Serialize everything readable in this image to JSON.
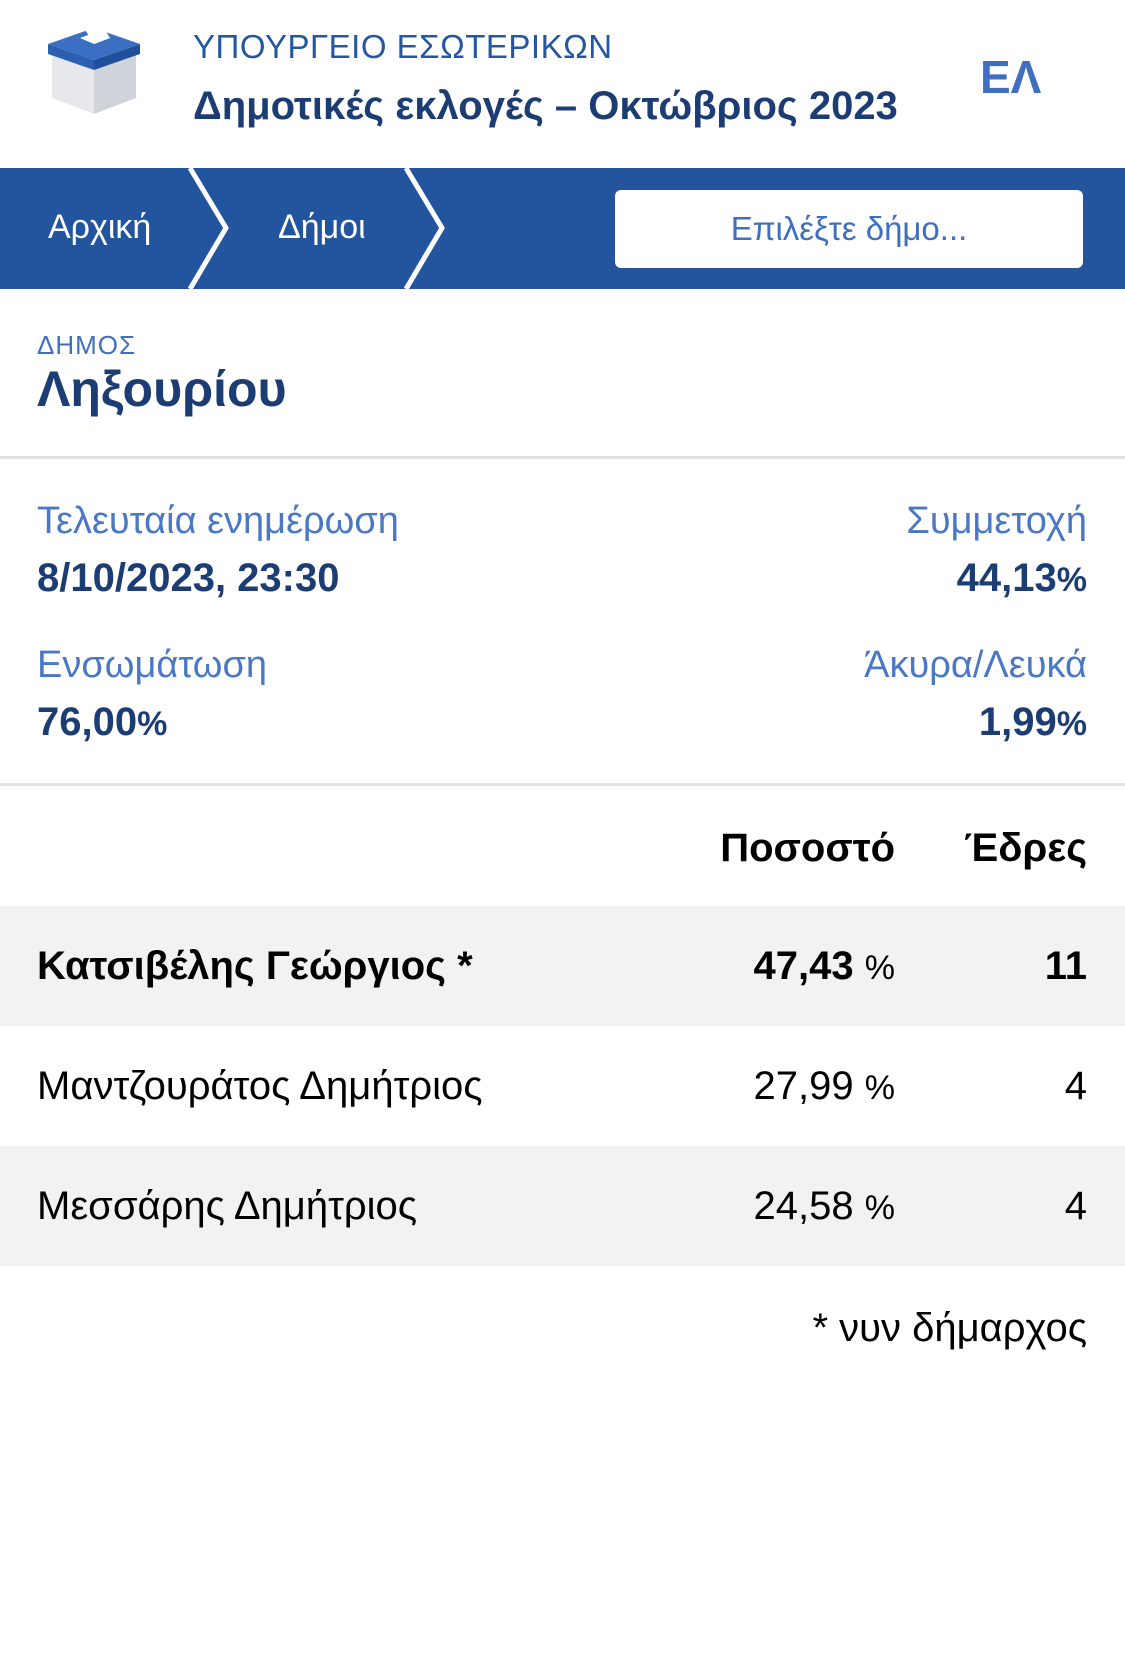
{
  "header": {
    "ministry": "ΥΠΟΥΡΓΕΙΟ ΕΣΩΤΕΡΙΚΩΝ",
    "election_title": "Δημοτικές εκλογές – Οκτώβριος 2023",
    "language": "ΕΛ"
  },
  "navbar": {
    "breadcrumbs": [
      "Αρχική",
      "Δήμοι"
    ],
    "select_placeholder": "Επιλέξτε δήμο..."
  },
  "municipality": {
    "label": "ΔΗΜΟΣ",
    "name": "Ληξουρίου"
  },
  "stats": {
    "last_update_label": "Τελευταία ενημέρωση",
    "last_update_value": "8/10/2023, 23:30",
    "turnout_label": "Συμμετοχή",
    "turnout_value": "44,13",
    "integration_label": "Ενσωμάτωση",
    "integration_value": "76,00",
    "invalid_label": "Άκυρα/Λευκά",
    "invalid_value": "1,99",
    "percent_sign": "%"
  },
  "results": {
    "col_percentage": "Ποσοστό",
    "col_seats": "Έδρες",
    "rows": [
      {
        "candidate": "Κατσιβέλης Γεώργιος *",
        "percentage": "47,43",
        "unit": "%",
        "seats": "11"
      },
      {
        "candidate": "Μαντζουράτος Δημήτριος",
        "percentage": "27,99",
        "unit": "%",
        "seats": "4"
      },
      {
        "candidate": "Μεσσάρης Δημήτριος",
        "percentage": "24,58",
        "unit": "%",
        "seats": "4"
      }
    ],
    "footnote": "* νυν δήμαρχος"
  },
  "colors": {
    "navbar": "#23549e",
    "title": "#1c3d73",
    "accent": "#3f6fbe",
    "row_shade": "#f1f2f4"
  },
  "icons": {
    "logo": "ballot-box-icon"
  }
}
